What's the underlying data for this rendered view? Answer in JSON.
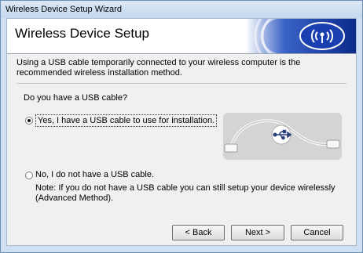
{
  "window": {
    "title": "Wireless Device Setup Wizard"
  },
  "banner": {
    "heading": "Wireless Device Setup",
    "logo_icon": "wireless-signal-icon"
  },
  "intro": "Using a USB cable temporarily connected to your wireless computer is the recommended wireless installation method.",
  "question": "Do you have a USB cable?",
  "options": [
    {
      "label": "Yes, I have a USB cable to use for installation.",
      "selected": true
    },
    {
      "label": "No, I do not have a USB cable.",
      "selected": false
    }
  ],
  "note": "Note: If you do not have a USB cable you can still setup your device wirelessly (Advanced Method).",
  "buttons": {
    "back": "< Back",
    "next": "Next >",
    "cancel": "Cancel"
  },
  "colors": {
    "banner_blue": "#1a3fb0",
    "accent_light": "#cfe0f2"
  }
}
